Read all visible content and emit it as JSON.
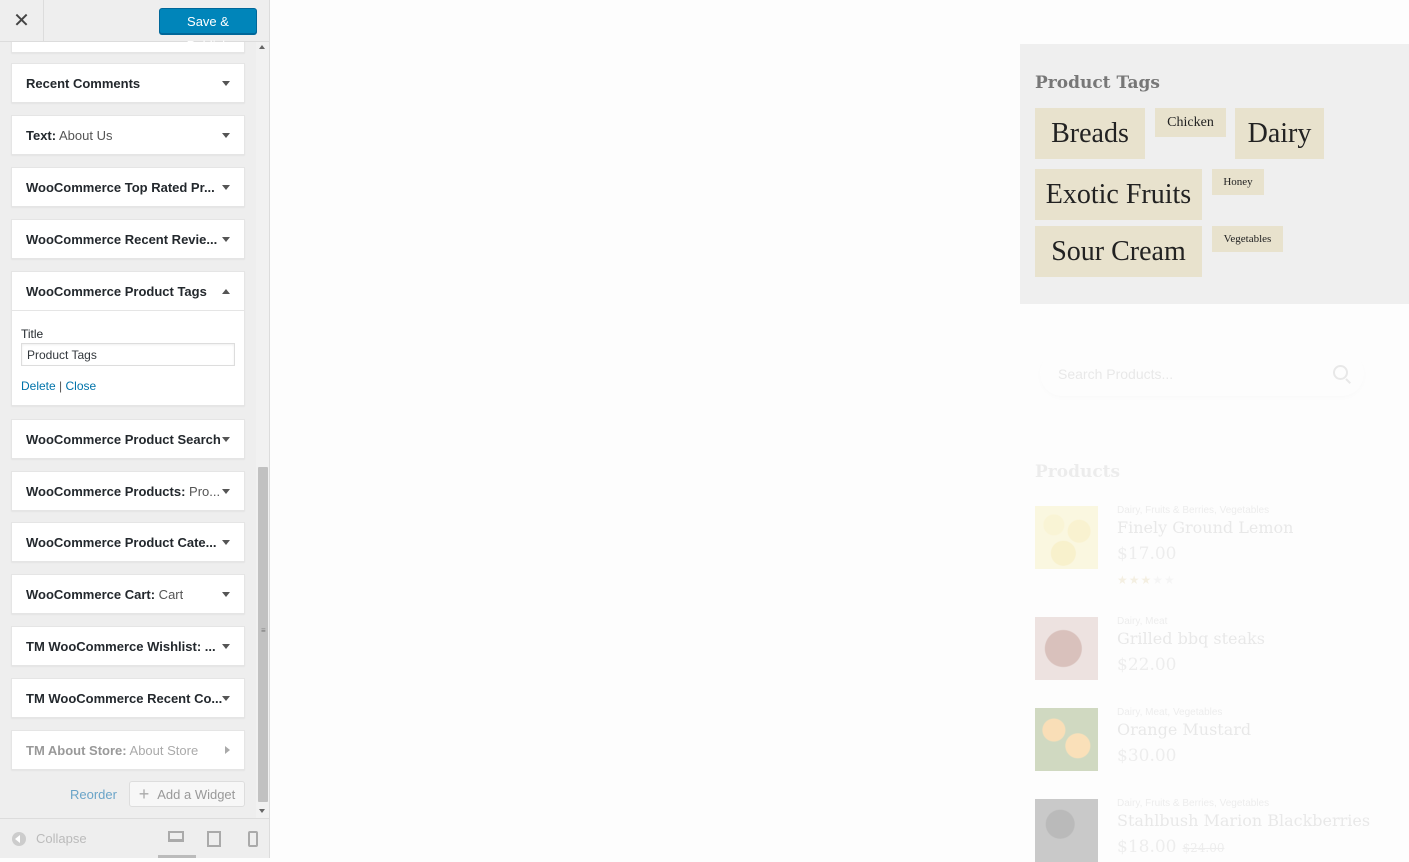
{
  "toolbar": {
    "close_icon": "close-icon",
    "save_label": "Save & Publish"
  },
  "widgets": [
    {
      "title": "Recent Comments",
      "subtitle": ""
    },
    {
      "title": "Text:",
      "subtitle": " About Us"
    },
    {
      "title": "WooCommerce Top Rated Pr...",
      "subtitle": ""
    },
    {
      "title": "WooCommerce Recent Revie...",
      "subtitle": ""
    },
    {
      "title": "WooCommerce Product Tags",
      "subtitle": ""
    },
    {
      "title": "WooCommerce Product Search",
      "subtitle": ""
    },
    {
      "title": "WooCommerce Products:",
      "subtitle": " Pro..."
    },
    {
      "title": "WooCommerce Product Cate...",
      "subtitle": ""
    },
    {
      "title": "WooCommerce Cart:",
      "subtitle": " Cart"
    },
    {
      "title": "TM WooCommerce Wishlist: ...",
      "subtitle": ""
    },
    {
      "title": "TM WooCommerce Recent Co...",
      "subtitle": ""
    },
    {
      "title": "TM About Store:",
      "subtitle": " About Store"
    }
  ],
  "expanded_widget": {
    "field_label": "Title",
    "field_value": "Product Tags",
    "delete_label": "Delete",
    "separator": "|",
    "close_label": "Close"
  },
  "actions": {
    "reorder_label": "Reorder",
    "add_widget_label": "Add a Widget"
  },
  "footer": {
    "collapse_label": "Collapse"
  },
  "preview": {
    "tags_title": "Product Tags",
    "tags": [
      "Breads",
      "Chicken",
      "Dairy",
      "Exotic Fruits",
      "Honey",
      "Sour Cream",
      "Vegetables"
    ],
    "search_placeholder": "Search Products...",
    "products_title": "Products",
    "products": [
      {
        "categories": "Dairy, Fruits & Berries, Vegetables",
        "name": "Finely Ground Lemon",
        "price": "$17.00",
        "old_price": "",
        "rating": 3
      },
      {
        "categories": "Dairy, Meat",
        "name": "Grilled bbq steaks",
        "price": "$22.00",
        "old_price": ""
      },
      {
        "categories": "Dairy, Meat, Vegetables",
        "name": "Orange Mustard",
        "price": "$30.00",
        "old_price": ""
      },
      {
        "categories": "Dairy, Fruits & Berries, Vegetables",
        "name": "Stahlbush Marion Blackberries",
        "price": "$18.00",
        "old_price": "$24.00"
      }
    ]
  },
  "colors": {
    "primary_button": "#0085ba",
    "link": "#0073aa",
    "tag_background": "#e8e2cd"
  }
}
